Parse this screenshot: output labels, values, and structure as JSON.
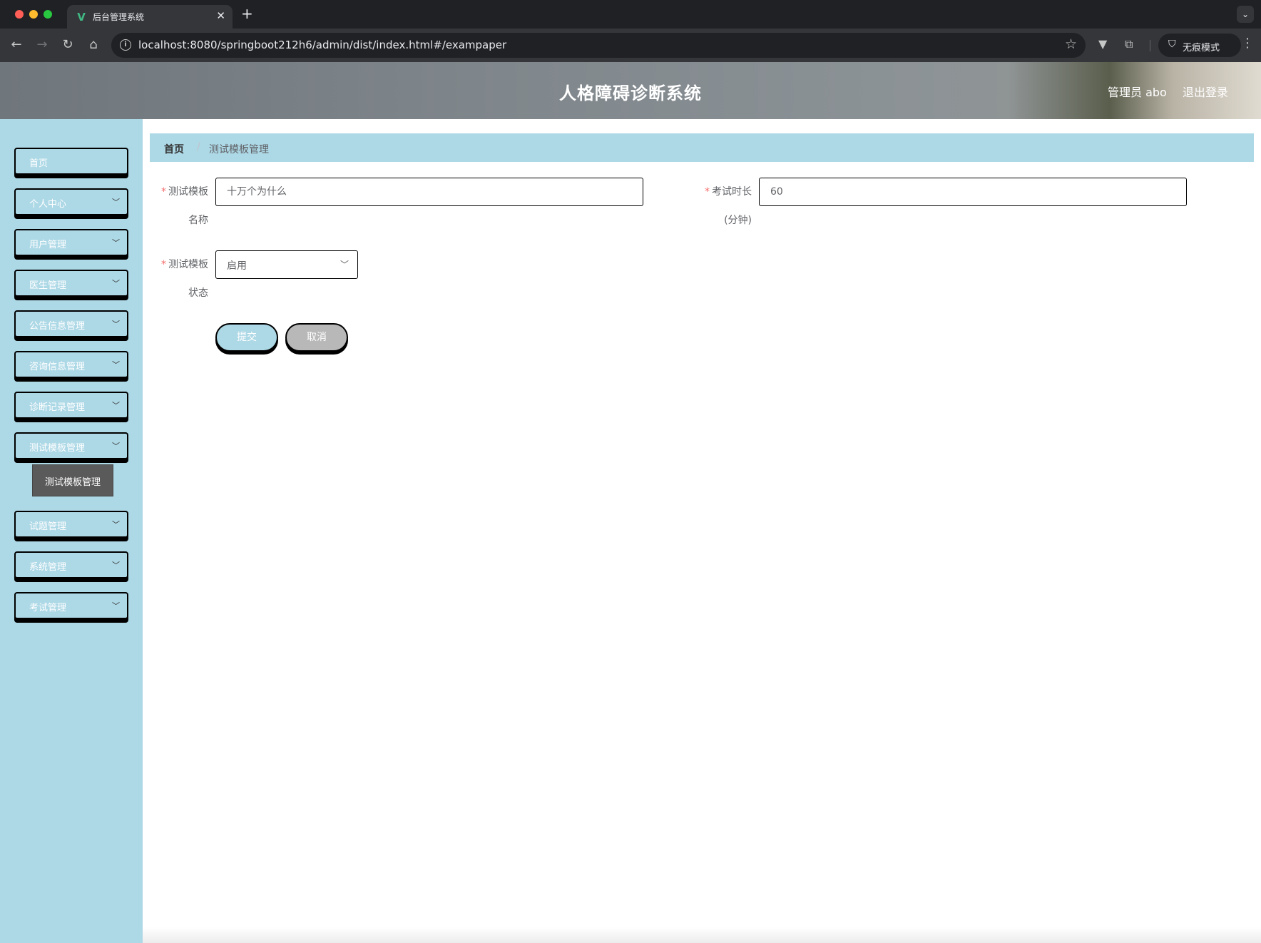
{
  "browser": {
    "tab_title": "后台管理系统",
    "url": "localhost:8080/springboot212h6/admin/dist/index.html#/exampaper",
    "incognito_label": "无痕模式"
  },
  "header": {
    "title": "人格障碍诊断系统",
    "admin": "管理员 abo",
    "logout": "退出登录"
  },
  "sidebar": {
    "items": [
      {
        "label": "首页"
      },
      {
        "label": "个人中心"
      },
      {
        "label": "用户管理"
      },
      {
        "label": "医生管理"
      },
      {
        "label": "公告信息管理"
      },
      {
        "label": "咨询信息管理"
      },
      {
        "label": "诊断记录管理"
      },
      {
        "label": "测试模板管理"
      },
      {
        "label": "试题管理"
      },
      {
        "label": "系统管理"
      },
      {
        "label": "考试管理"
      }
    ],
    "submenu_label": "测试模板管理"
  },
  "breadcrumb": {
    "home": "首页",
    "separator": "/",
    "current": "测试模板管理"
  },
  "form": {
    "name_label_line1": "测试模板",
    "name_label_line2": "名称",
    "name_value": "十万个为什么",
    "duration_label_line1": "考试时长",
    "duration_label_line2": "(分钟)",
    "duration_value": "60",
    "status_label_line1": "测试模板",
    "status_label_line2": "状态",
    "status_value": "启用",
    "submit": "提交",
    "cancel": "取消",
    "required_mark": "*"
  }
}
